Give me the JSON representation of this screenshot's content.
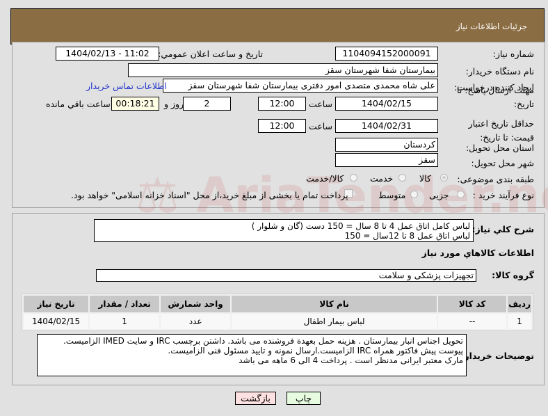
{
  "header": {
    "title": "جزئیات اطلاعات نیاز"
  },
  "form": {
    "need_number_label": "شماره نیاز:",
    "need_number": "1104094152000091",
    "announce_label": "تاریخ و ساعت اعلان عمومي:",
    "announce_value": "1404/02/13 - 11:02",
    "buyer_org_label": "نام دستگاه خریدار:",
    "buyer_org": "بیمارستان شفا شهرستان سقز",
    "creator_label": "ایجاد کننده درخواست:",
    "creator": "علی شاه محمدی متصدی امور دفتری بیمارستان شفا شهرستان سقز",
    "contact_link": "اطلاعات تماس خریدار",
    "deadline_label": "مهلت ارسال پاسخ: تا تاریخ:",
    "deadline_date": "1404/02/15",
    "time_label": "ساعت",
    "deadline_time": "12:00",
    "days": "2",
    "days_label": "روز و",
    "remaining_time": "00:18:21",
    "remaining_label": "ساعت باقي مانده",
    "validity_label": "حداقل تاریخ اعتبار قیمت: تا تاریخ:",
    "validity_date": "1404/02/31",
    "validity_time": "12:00",
    "province_label": "استان محل تحویل:",
    "province": "کردستان",
    "city_label": "شهر محل تحویل:",
    "city": "سقز",
    "category_label": "طبقه بندی موضوعی:",
    "category_options": [
      "کالا",
      "خدمت",
      "کالا/خدمت"
    ],
    "process_label": "نوع فرآیند خرید :",
    "process_options": [
      "جزیی",
      "متوسط"
    ],
    "process_note": "پرداخت تمام یا بخشی از مبلغ خرید،از محل \"اسناد خزانه اسلامی\" خواهد بود."
  },
  "details": {
    "desc_label": "شرح کلي نیاز:",
    "desc_lines": [
      "لباس کامل اتاق عمل 4 تا 8 سال  = 150 دست (گان و شلوار )",
      "لباس اتاق عمل 8 تا 12سال  = 150"
    ],
    "goods_heading": "اطلاعات کالاهاي مورد نیاز",
    "group_label": "گروه کالا:",
    "group": "تجهیزات پزشکی و سلامت",
    "table": {
      "headers": [
        "ردیف",
        "کد کالا",
        "نام کالا",
        "واحد شمارش",
        "تعداد / مقدار",
        "تاریخ نیاز"
      ],
      "rows": [
        [
          "1",
          "--",
          "لباس بیمار اطفال",
          "عدد",
          "1",
          "1404/02/15"
        ]
      ]
    },
    "notes_label": "توضیحات خریدار:",
    "notes_lines": [
      "تحویل اجناس  انبار بیمارستان . هزینه حمل بعهدة فروشنده می باشد.  داشتن برچسب IRC  و سایت  IMED  الزامیست.",
      "پیوست پیش فاکتور همراه IRC  الزامیست.ارسال نمونه و تایید مسئول فنی الزامیست.",
      "مارک معتبر ایرانی مدنظر است . پرداخت 4 الی 6 ماهه می باشد"
    ]
  },
  "buttons": {
    "back": "بازگشت",
    "print": "چاپ"
  },
  "watermark": "AriaTender.net"
}
